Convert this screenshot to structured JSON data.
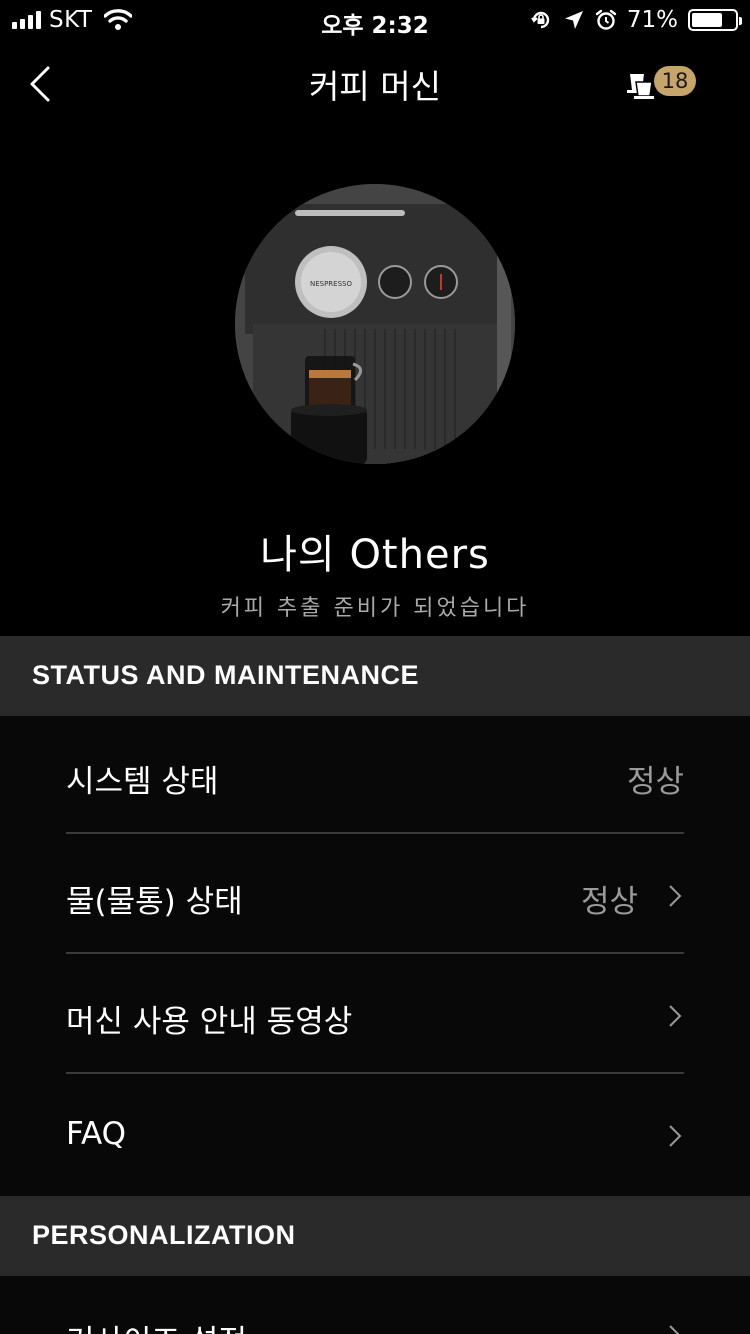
{
  "status_bar": {
    "carrier": "SKT",
    "time": "오후 2:32",
    "battery_percent": "71%",
    "battery_level": 0.71,
    "icons": [
      "signal-icon",
      "wifi-icon",
      "rotation-lock-icon",
      "location-arrow-icon",
      "alarm-icon",
      "battery-icon"
    ]
  },
  "nav": {
    "title": "커피 머신",
    "back_icon": "chevron-left-icon",
    "cart_icon": "capsule-icon",
    "cart_count": "18",
    "badge_color": "#c7a46a"
  },
  "machine": {
    "brand": "NESPRESSO",
    "name": "나의 Others",
    "status": "커피 추출 준비가 되었습니다"
  },
  "sections": {
    "status_maintenance": {
      "header": "STATUS AND MAINTENANCE",
      "rows": [
        {
          "label": "시스템 상태",
          "value": "정상"
        },
        {
          "label": "물(물통) 상태",
          "value": "정상"
        },
        {
          "label": "머신 사용 안내 동영상",
          "value": ""
        },
        {
          "label": "FAQ",
          "value": ""
        }
      ]
    },
    "personalization": {
      "header": "PERSONALIZATION",
      "rows": [
        {
          "label": "커사이즈 설정",
          "value": ""
        }
      ]
    }
  }
}
